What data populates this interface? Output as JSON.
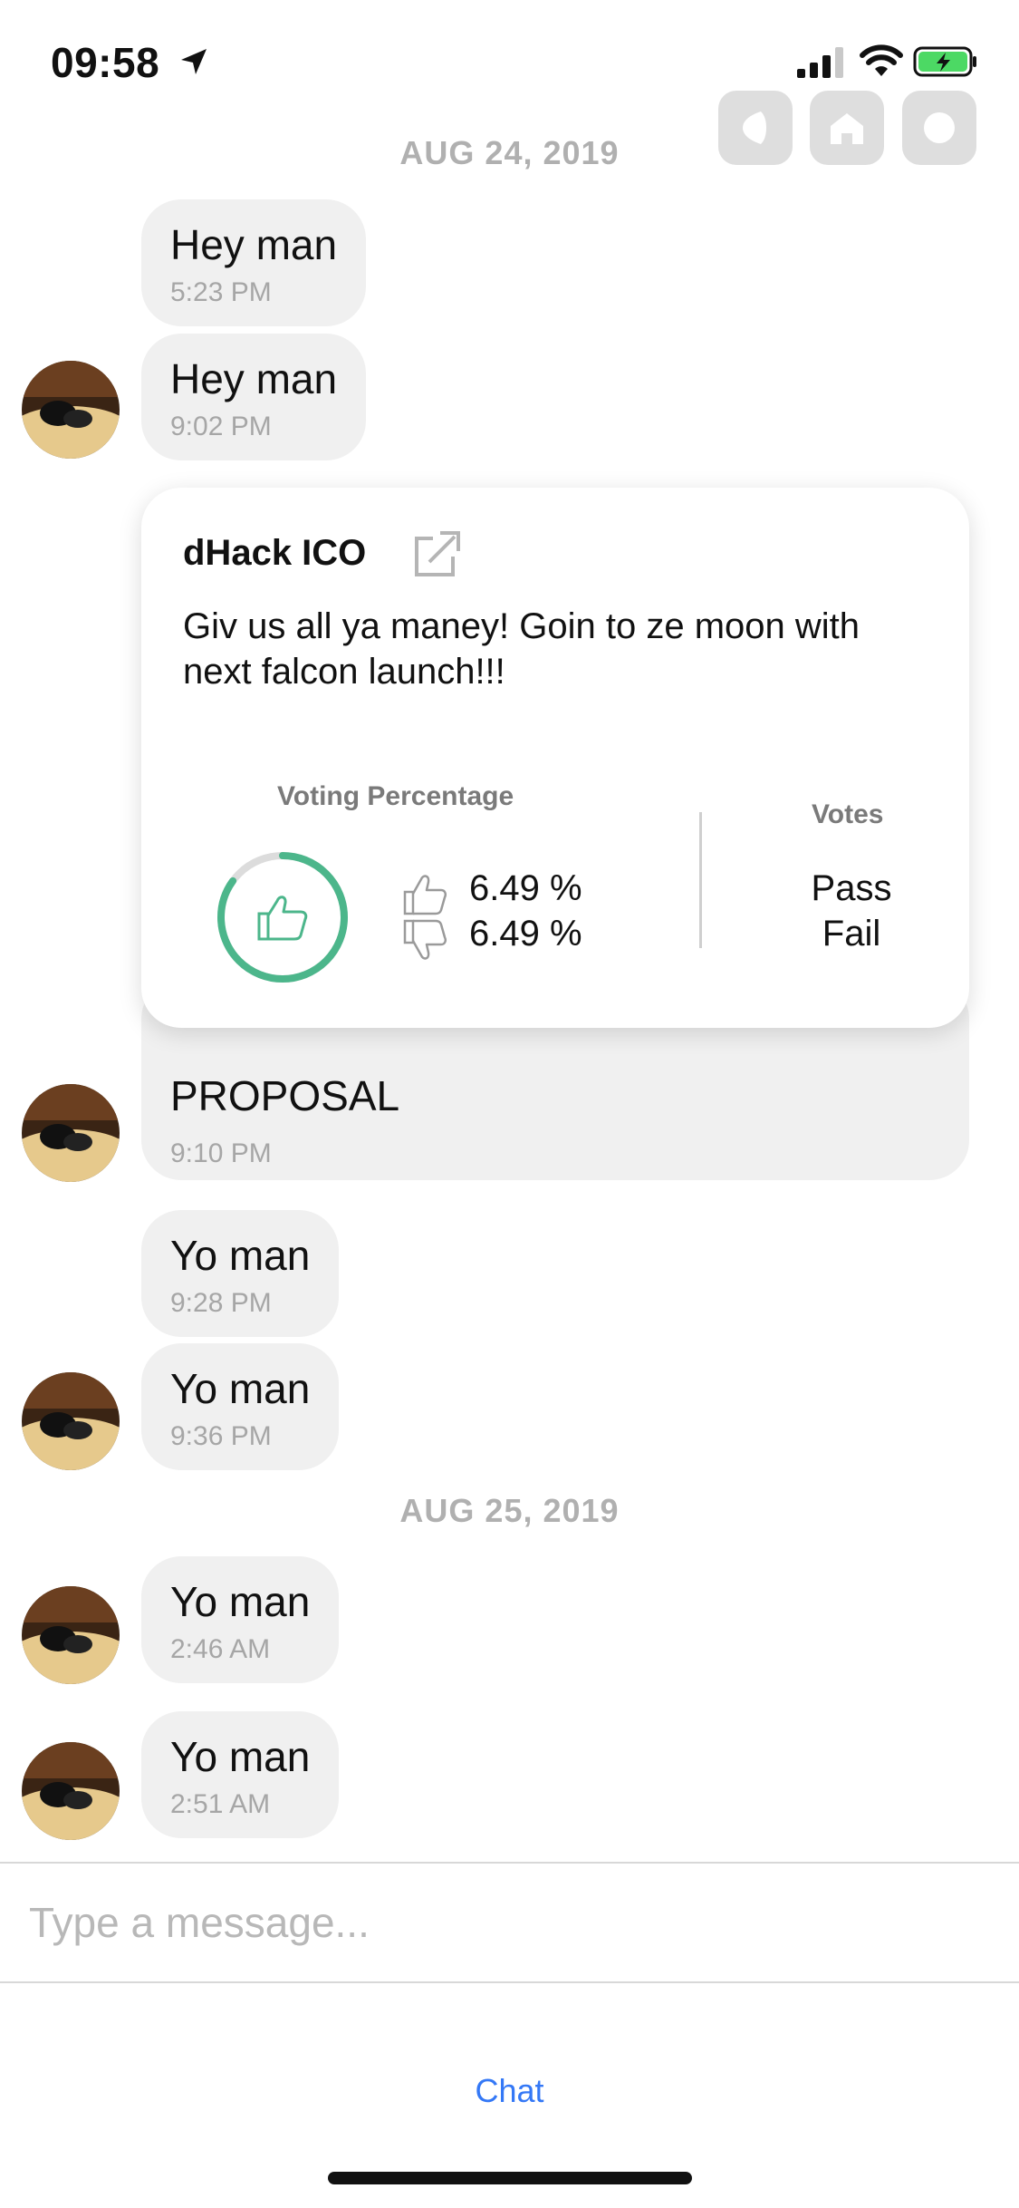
{
  "status_bar": {
    "time": "09:58",
    "location_icon": "location-arrow-icon",
    "signal_icon": "cellular-signal-icon",
    "wifi_icon": "wifi-icon",
    "battery_icon": "battery-charging-icon",
    "battery_color": "#4cd964"
  },
  "top_buttons": [
    {
      "name": "back-button",
      "icon": "back-icon"
    },
    {
      "name": "home-button",
      "icon": "home-icon"
    },
    {
      "name": "record-button",
      "icon": "circle-icon"
    }
  ],
  "messages_day1": {
    "date": "AUG 24, 2019",
    "m1": {
      "text": "Hey man",
      "time": "5:23 PM"
    },
    "m2": {
      "text": "Hey man",
      "time": "9:02 PM"
    },
    "proposal": {
      "title": "dHack ICO",
      "description": "Giv us all ya maney! Goin to ze moon with next falcon launch!!!",
      "voting_heading": "Voting Percentage",
      "pass_pct": "6.49 %",
      "fail_pct": "6.49 %",
      "votes_heading": "Votes",
      "pass_label": "Pass",
      "fail_label": "Fail",
      "gauge_fraction": 0.85,
      "accent": "#4cb68b",
      "label": "PROPOSAL",
      "time": "9:10 PM"
    },
    "m3": {
      "text": "Yo man",
      "time": "9:28 PM"
    },
    "m4": {
      "text": "Yo man",
      "time": "9:36 PM"
    }
  },
  "messages_day2": {
    "date": "AUG 25, 2019",
    "m1": {
      "text": "Yo man",
      "time": "2:46 AM"
    },
    "m2": {
      "text": "Yo man",
      "time": "2:51 AM"
    }
  },
  "composer": {
    "placeholder": "Type a message..."
  },
  "tab_bar": {
    "chat_label": "Chat",
    "accent": "#3478f6"
  }
}
